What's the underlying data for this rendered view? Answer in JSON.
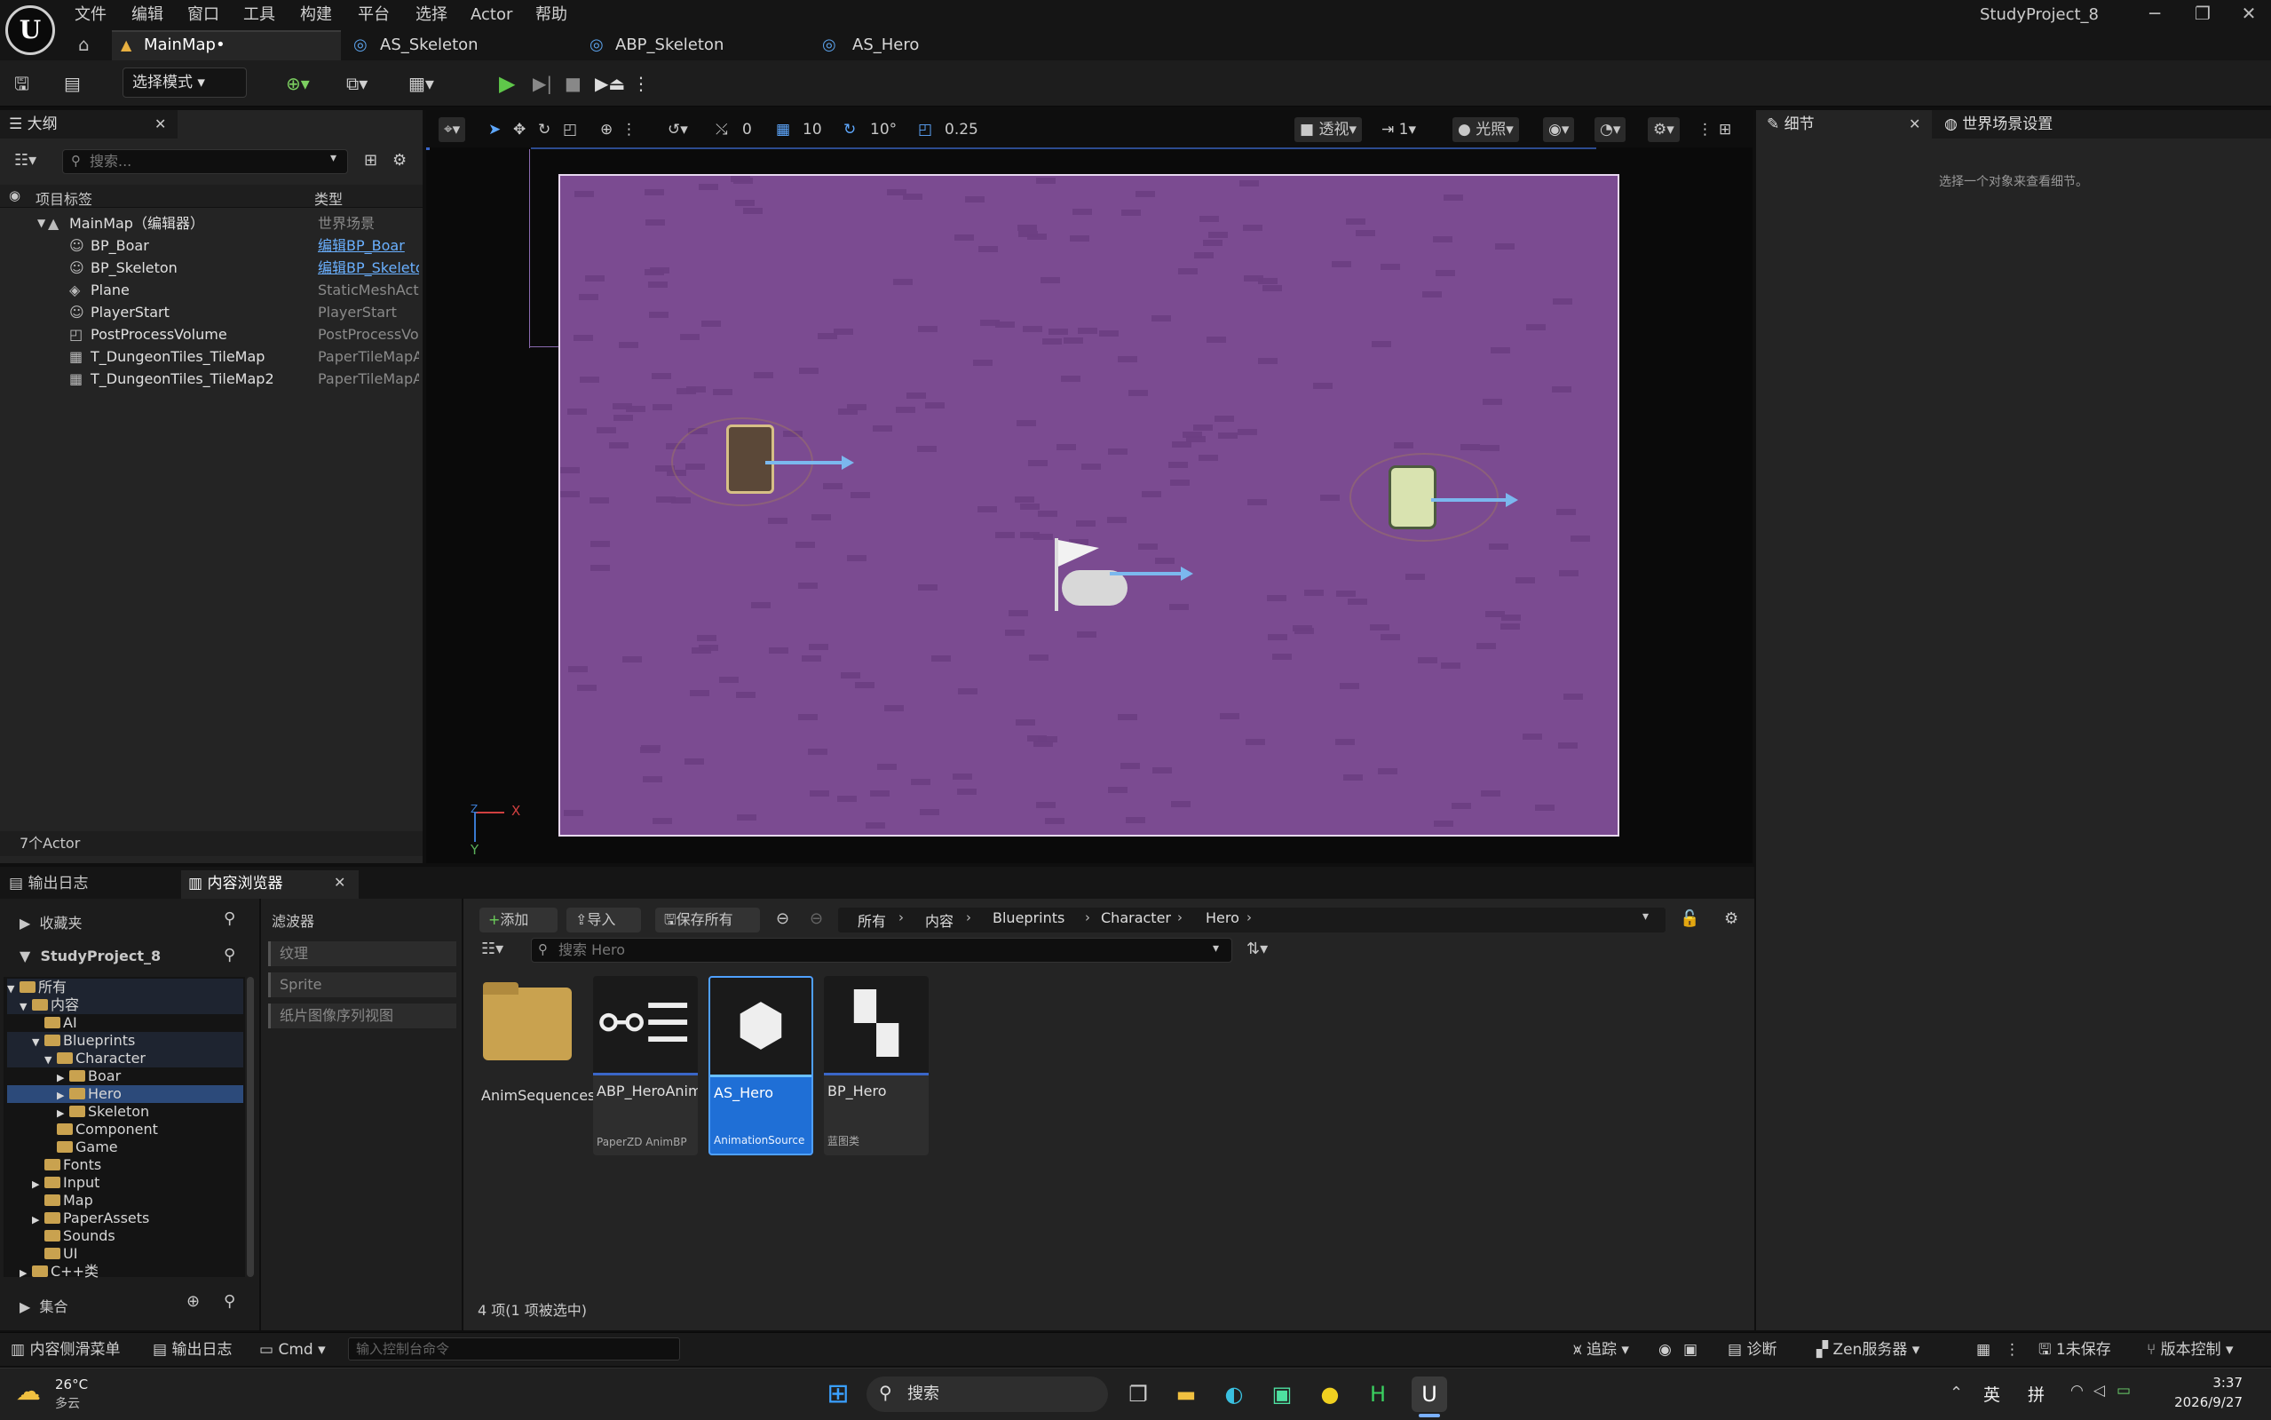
{
  "menu": [
    "文件",
    "编辑",
    "窗口",
    "工具",
    "构建",
    "选择",
    "平台",
    "Actor",
    "帮助"
  ],
  "project_name": "StudyProject_8",
  "tabs": [
    {
      "label": "MainMap•"
    },
    {
      "label": "AS_Skeleton"
    },
    {
      "label": "ABP_Skeleton"
    },
    {
      "label": "AS_Hero"
    }
  ],
  "toolbar": {
    "mode_label": "选择模式"
  },
  "viewport": {
    "snap_translate": "0",
    "grid_size": "10",
    "rot_snap": "10°",
    "scale_snap": "0.25",
    "view_mode": "透视",
    "lit": "光照",
    "cam_speed": "1",
    "axis_x": "X",
    "axis_y": "Y",
    "axis_z": "Z"
  },
  "outliner": {
    "title": "大纲",
    "search_placeholder": "搜索...",
    "col_label": "项目标签",
    "col_type": "类型",
    "rows": [
      {
        "label": "MainMap（编辑器）",
        "type": "世界场景"
      },
      {
        "label": "BP_Boar",
        "type": "编辑BP_Boar"
      },
      {
        "label": "BP_Skeleton",
        "type": "编辑BP_Skeleton"
      },
      {
        "label": "Plane",
        "type": "StaticMeshActor"
      },
      {
        "label": "PlayerStart",
        "type": "PlayerStart"
      },
      {
        "label": "PostProcessVolume",
        "type": "PostProcessVolume"
      },
      {
        "label": "T_DungeonTiles_TileMap",
        "type": "PaperTileMapActor"
      },
      {
        "label": "T_DungeonTiles_TileMap2",
        "type": "PaperTileMapActor"
      }
    ],
    "count": "7个Actor"
  },
  "details": {
    "tab1": "细节",
    "tab2": "世界场景设置",
    "empty_msg": "选择一个对象来查看细节。"
  },
  "bottom_tabs": {
    "output_log": "输出日志",
    "content_browser": "内容浏览器"
  },
  "sources": {
    "favorites": "收藏夹",
    "project": "StudyProject_8",
    "collections": "集合",
    "tree": [
      {
        "label": "所有",
        "depth": 0,
        "arrow": "▼"
      },
      {
        "label": "内容",
        "depth": 1,
        "arrow": "▼"
      },
      {
        "label": "AI",
        "depth": 2,
        "arrow": ""
      },
      {
        "label": "Blueprints",
        "depth": 2,
        "arrow": "▼"
      },
      {
        "label": "Character",
        "depth": 3,
        "arrow": "▼"
      },
      {
        "label": "Boar",
        "depth": 4,
        "arrow": "▶"
      },
      {
        "label": "Hero",
        "depth": 4,
        "arrow": "▶"
      },
      {
        "label": "Skeleton",
        "depth": 4,
        "arrow": "▶"
      },
      {
        "label": "Component",
        "depth": 3,
        "arrow": ""
      },
      {
        "label": "Game",
        "depth": 3,
        "arrow": ""
      },
      {
        "label": "Fonts",
        "depth": 2,
        "arrow": ""
      },
      {
        "label": "Input",
        "depth": 2,
        "arrow": "▶"
      },
      {
        "label": "Map",
        "depth": 2,
        "arrow": ""
      },
      {
        "label": "PaperAssets",
        "depth": 2,
        "arrow": "▶"
      },
      {
        "label": "Sounds",
        "depth": 2,
        "arrow": ""
      },
      {
        "label": "UI",
        "depth": 2,
        "arrow": ""
      },
      {
        "label": "C++类",
        "depth": 1,
        "arrow": "▶"
      }
    ]
  },
  "filters": {
    "title": "滤波器",
    "items": [
      "纹理",
      "Sprite",
      "纸片图像序列视图"
    ]
  },
  "cb": {
    "add": "添加",
    "import": "导入",
    "save_all": "保存所有",
    "path": [
      "所有",
      "内容",
      "Blueprints",
      "Character",
      "Hero"
    ],
    "search_placeholder": "搜索 Hero",
    "status": "4 项(1 项被选中)",
    "assets": [
      {
        "name": "AnimSequences",
        "type": "",
        "kind": "folder"
      },
      {
        "name": "ABP_HeroAnim",
        "type": "PaperZD AnimBP",
        "kind": "anim"
      },
      {
        "name": "AS_Hero",
        "type": "AnimationSource",
        "kind": "source"
      },
      {
        "name": "BP_Hero",
        "type": "蓝图类",
        "kind": "bp"
      }
    ]
  },
  "status": {
    "drawer": "内容侧滑菜单",
    "output": "输出日志",
    "cmd": "Cmd",
    "console_placeholder": "输入控制台命令",
    "trace": "追踪",
    "diag": "诊断",
    "zen": "Zen服务器",
    "unsaved": "1未保存",
    "vc": "版本控制"
  },
  "taskbar": {
    "temp": "26°C",
    "weather": "多云",
    "search": "搜索",
    "ime1": "英",
    "ime2": "拼",
    "time": "3:37",
    "date": "2026/9/27"
  }
}
